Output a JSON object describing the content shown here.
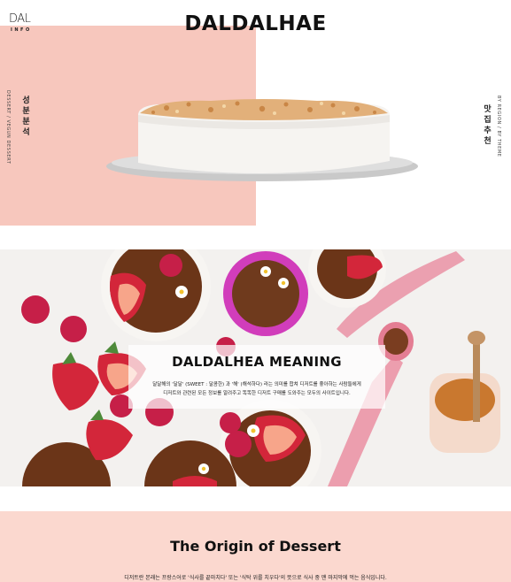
{
  "header": {
    "logo_top": "DAL",
    "logo_bottom": "INFO",
    "site_title": "DALDALHAE"
  },
  "nav": {
    "left_main": "성분분석",
    "left_sub": "DESSERT / VEGUN DESSERT",
    "right_main": "맛집추천",
    "right_sub": "BY REGION / BY THEME"
  },
  "meaning": {
    "title": "DALDALHEA MEANING",
    "line1": "달달해의 '달달' (SWEET : 달콤한) 과 '해' (해석하다) 라는 의미를 합쳐 디저트를 좋아하는 사람들에게",
    "line2": "디저트와 관련된 모든 정보를 알려주고 똑똑한 디저트 구매를 도와주는 모두의 사이트입니다."
  },
  "origin": {
    "title": "The Origin of Dessert",
    "text": "디저트란 본래는 프랑스어로 '식사를 끝마치다' 또는 '식탁 위를 치우다'의 뜻으로 식사 중 맨 마지막에 먹는 음식입니다."
  },
  "colors": {
    "pink_block": "#f7c7bd",
    "origin_bg": "#fbd8cf"
  }
}
